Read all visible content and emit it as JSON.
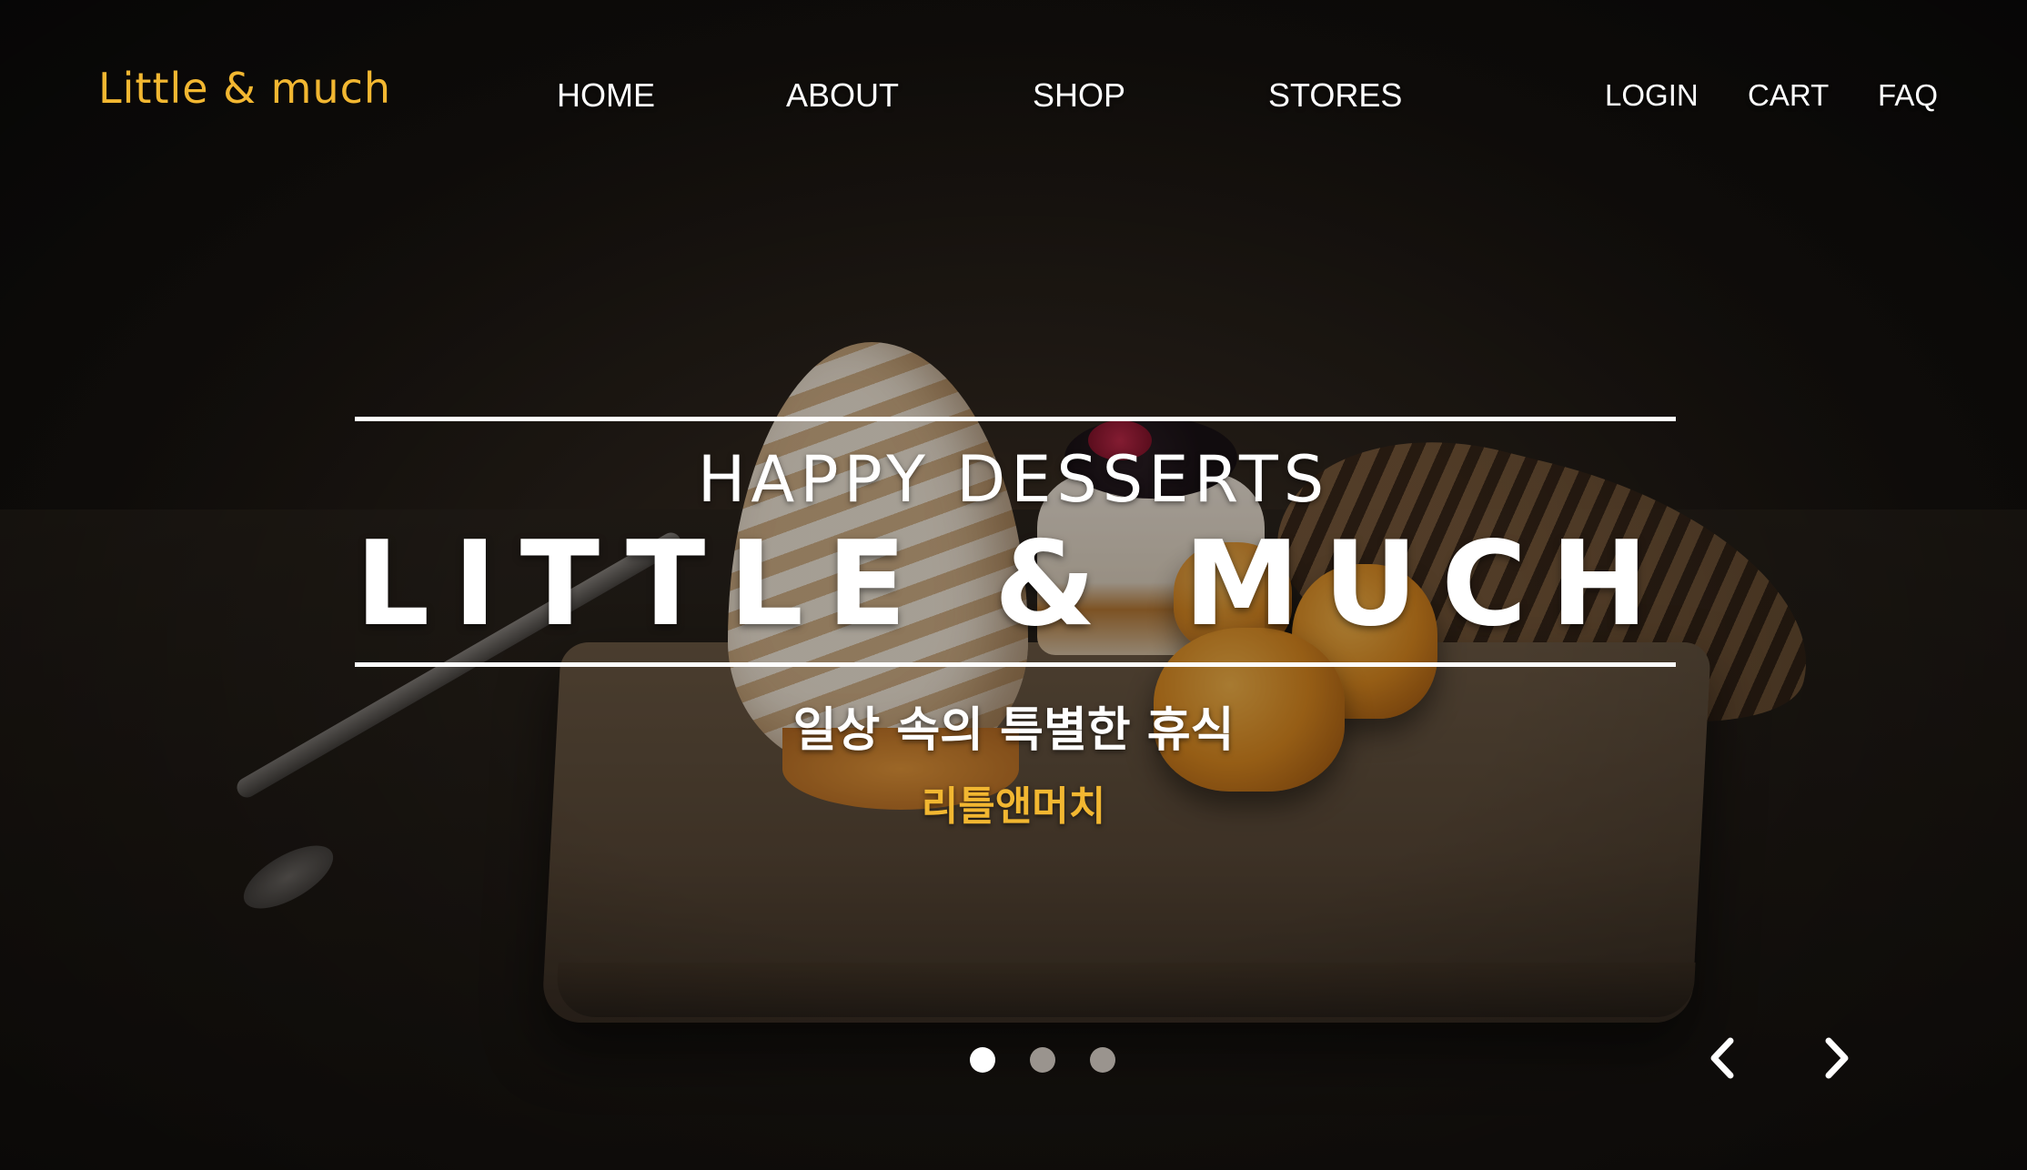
{
  "header": {
    "logo": "Little & much",
    "main_nav": [
      "HOME",
      "ABOUT",
      "SHOP",
      "STORES"
    ],
    "util_nav": [
      "LOGIN",
      "CART",
      "FAQ"
    ]
  },
  "hero": {
    "subtitle": "HAPPY DESSERTS",
    "title": "LITTLE & MUCH",
    "tagline_kr": "일상 속의 특별한 휴식",
    "brand_kr": "리틀앤머치",
    "background_image": "dessert-meringue-photo"
  },
  "carousel": {
    "slide_count": 3,
    "active_slide": 1,
    "prev_icon": "chevron-left-icon",
    "next_icon": "chevron-right-icon"
  },
  "colors": {
    "accent": "#f2b731",
    "text": "#ffffff",
    "dot_inactive": "#9a948e"
  }
}
